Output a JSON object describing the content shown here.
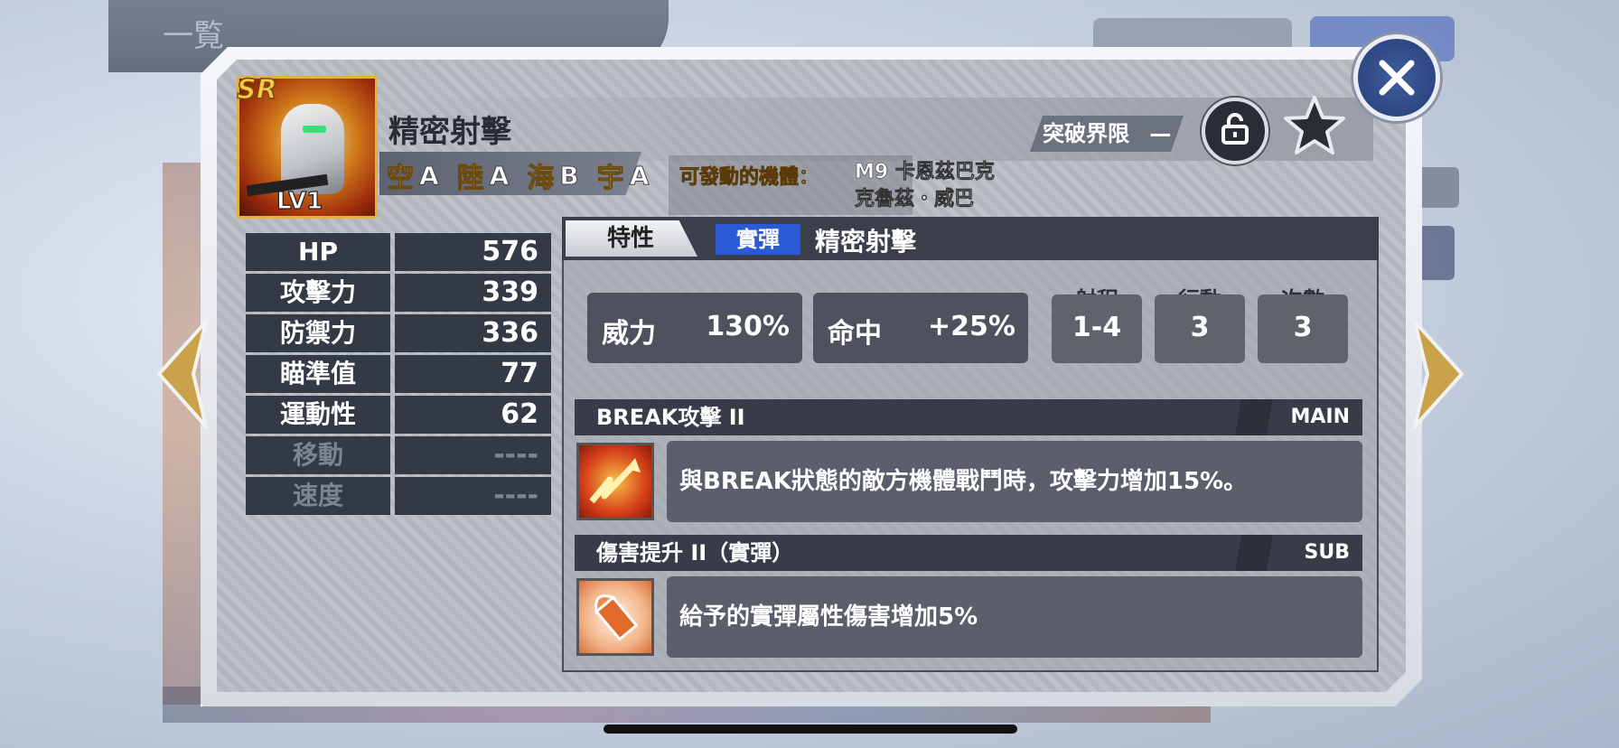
{
  "background": {
    "top_label": "一覧"
  },
  "unit": {
    "rarity": "SR",
    "level": "LV1"
  },
  "skill": {
    "title": "精密射擊",
    "terrain": [
      {
        "t": "空",
        "g": "A"
      },
      {
        "t": "陸",
        "g": "A"
      },
      {
        "t": "海",
        "g": "B"
      },
      {
        "t": "宇",
        "g": "A"
      }
    ],
    "usable_label": "可發動的機體：",
    "usable_units": [
      "M9 卡恩茲巴克",
      "克魯茲・威巴"
    ]
  },
  "limit_break": {
    "label": "突破界限",
    "value": "—"
  },
  "stats": [
    {
      "k": "HP",
      "v": "576",
      "dim": false
    },
    {
      "k": "攻擊力",
      "v": "339",
      "dim": false
    },
    {
      "k": "防禦力",
      "v": "336",
      "dim": false
    },
    {
      "k": "瞄準值",
      "v": "77",
      "dim": false
    },
    {
      "k": "運動性",
      "v": "62",
      "dim": false
    },
    {
      "k": "移動",
      "v": "----",
      "dim": true
    },
    {
      "k": "速度",
      "v": "----",
      "dim": true
    }
  ],
  "detail": {
    "tab_trait": "特性",
    "tab_type": "實彈",
    "tab_name": "精密射擊",
    "power_label": "威力",
    "power_value": "130%",
    "hit_label": "命中",
    "hit_value": "+25%",
    "range_label": "射程",
    "range_value": "1-4",
    "action_label": "行動",
    "action_value": "3",
    "count_label": "次數",
    "count_value": "3"
  },
  "abilities": [
    {
      "name": "BREAK攻擊 II",
      "tag": "MAIN",
      "desc": "與BREAK狀態的敵方機體戰鬥時，攻擊力增加15%。",
      "icon": "break-attack-icon"
    },
    {
      "name": "傷害提升 II（實彈）",
      "tag": "SUB",
      "desc": "給予的實彈屬性傷害增加5%",
      "icon": "bullet-damage-icon"
    }
  ],
  "colors": {
    "accent_gold": "#f0b736",
    "tab_blue": "#2a5ad6",
    "close_blue": "#2f4d8c"
  }
}
